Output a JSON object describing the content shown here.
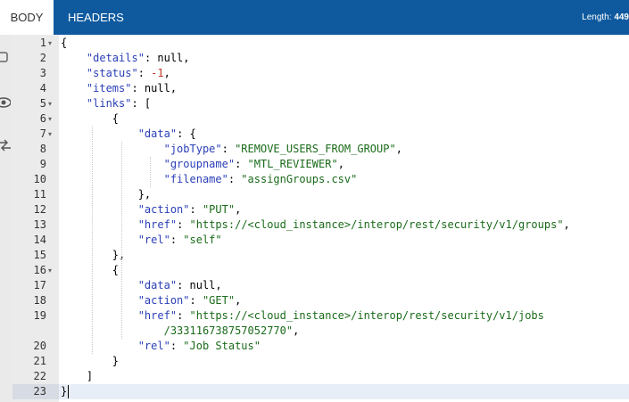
{
  "tabs": [
    {
      "label": "BODY",
      "active": true
    },
    {
      "label": "HEADERS",
      "active": false
    }
  ],
  "length": {
    "label": "Length:",
    "value": "449"
  },
  "side_tools": [
    {
      "icon": "copy-icon"
    },
    {
      "icon": "eye-icon"
    },
    {
      "icon": "swap-icon"
    }
  ],
  "colors": {
    "tabbar": "#0f5a9f",
    "key": "#2a3fb8",
    "string": "#1a6b1a",
    "number": "#c0392b",
    "gutter": "#ebebeb",
    "active_line": "#e8eef8"
  },
  "code": {
    "lines": [
      {
        "num": "1",
        "fold": true,
        "segments": [
          [
            "p",
            "{"
          ]
        ]
      },
      {
        "num": "2",
        "fold": false,
        "segments": [
          [
            "p",
            "    "
          ],
          [
            "k",
            "\"details\""
          ],
          [
            "p",
            ": null,"
          ]
        ]
      },
      {
        "num": "3",
        "fold": false,
        "segments": [
          [
            "p",
            "    "
          ],
          [
            "k",
            "\"status\""
          ],
          [
            "p",
            ": "
          ],
          [
            "n",
            "-1"
          ],
          [
            "p",
            ","
          ]
        ]
      },
      {
        "num": "4",
        "fold": false,
        "segments": [
          [
            "p",
            "    "
          ],
          [
            "k",
            "\"items\""
          ],
          [
            "p",
            ": null,"
          ]
        ]
      },
      {
        "num": "5",
        "fold": true,
        "segments": [
          [
            "p",
            "    "
          ],
          [
            "k",
            "\"links\""
          ],
          [
            "p",
            ": ["
          ]
        ]
      },
      {
        "num": "6",
        "fold": true,
        "segments": [
          [
            "p",
            "        {"
          ]
        ]
      },
      {
        "num": "7",
        "fold": true,
        "segments": [
          [
            "p",
            "            "
          ],
          [
            "k",
            "\"data\""
          ],
          [
            "p",
            ": {"
          ]
        ]
      },
      {
        "num": "8",
        "fold": false,
        "segments": [
          [
            "p",
            "                "
          ],
          [
            "k",
            "\"jobType\""
          ],
          [
            "p",
            ": "
          ],
          [
            "s",
            "\"REMOVE_USERS_FROM_GROUP\""
          ],
          [
            "p",
            ","
          ]
        ]
      },
      {
        "num": "9",
        "fold": false,
        "segments": [
          [
            "p",
            "                "
          ],
          [
            "k",
            "\"groupname\""
          ],
          [
            "p",
            ": "
          ],
          [
            "s",
            "\"MTL_REVIEWER\""
          ],
          [
            "p",
            ","
          ]
        ]
      },
      {
        "num": "10",
        "fold": false,
        "segments": [
          [
            "p",
            "                "
          ],
          [
            "k",
            "\"filename\""
          ],
          [
            "p",
            ": "
          ],
          [
            "s",
            "\"assignGroups.csv\""
          ]
        ]
      },
      {
        "num": "11",
        "fold": false,
        "segments": [
          [
            "p",
            "            },"
          ]
        ]
      },
      {
        "num": "12",
        "fold": false,
        "segments": [
          [
            "p",
            "            "
          ],
          [
            "k",
            "\"action\""
          ],
          [
            "p",
            ": "
          ],
          [
            "s",
            "\"PUT\""
          ],
          [
            "p",
            ","
          ]
        ]
      },
      {
        "num": "13",
        "fold": false,
        "segments": [
          [
            "p",
            "            "
          ],
          [
            "k",
            "\"href\""
          ],
          [
            "p",
            ": "
          ],
          [
            "s",
            "\"https://<cloud_instance>/interop/rest/security/v1/groups\""
          ],
          [
            "p",
            ","
          ]
        ]
      },
      {
        "num": "14",
        "fold": false,
        "segments": [
          [
            "p",
            "            "
          ],
          [
            "k",
            "\"rel\""
          ],
          [
            "p",
            ": "
          ],
          [
            "s",
            "\"self\""
          ]
        ]
      },
      {
        "num": "15",
        "fold": false,
        "segments": [
          [
            "p",
            "        },"
          ]
        ]
      },
      {
        "num": "16",
        "fold": true,
        "segments": [
          [
            "p",
            "        {"
          ]
        ]
      },
      {
        "num": "17",
        "fold": false,
        "segments": [
          [
            "p",
            "            "
          ],
          [
            "k",
            "\"data\""
          ],
          [
            "p",
            ": null,"
          ]
        ]
      },
      {
        "num": "18",
        "fold": false,
        "segments": [
          [
            "p",
            "            "
          ],
          [
            "k",
            "\"action\""
          ],
          [
            "p",
            ": "
          ],
          [
            "s",
            "\"GET\""
          ],
          [
            "p",
            ","
          ]
        ]
      },
      {
        "num": "19",
        "fold": false,
        "segments": [
          [
            "p",
            "            "
          ],
          [
            "k",
            "\"href\""
          ],
          [
            "p",
            ": "
          ],
          [
            "s",
            "\"https://<cloud_instance>/interop/rest/security/v1/jobs"
          ]
        ]
      },
      {
        "num": "",
        "fold": false,
        "segments": [
          [
            "s",
            "                /333116738757052770\""
          ],
          [
            "p",
            ","
          ]
        ]
      },
      {
        "num": "20",
        "fold": false,
        "segments": [
          [
            "p",
            "            "
          ],
          [
            "k",
            "\"rel\""
          ],
          [
            "p",
            ": "
          ],
          [
            "s",
            "\"Job Status\""
          ]
        ]
      },
      {
        "num": "21",
        "fold": false,
        "segments": [
          [
            "p",
            "        }"
          ]
        ]
      },
      {
        "num": "22",
        "fold": false,
        "segments": [
          [
            "p",
            "    ]"
          ]
        ]
      },
      {
        "num": "23",
        "fold": false,
        "segments": [
          [
            "p",
            "}"
          ]
        ]
      }
    ]
  }
}
